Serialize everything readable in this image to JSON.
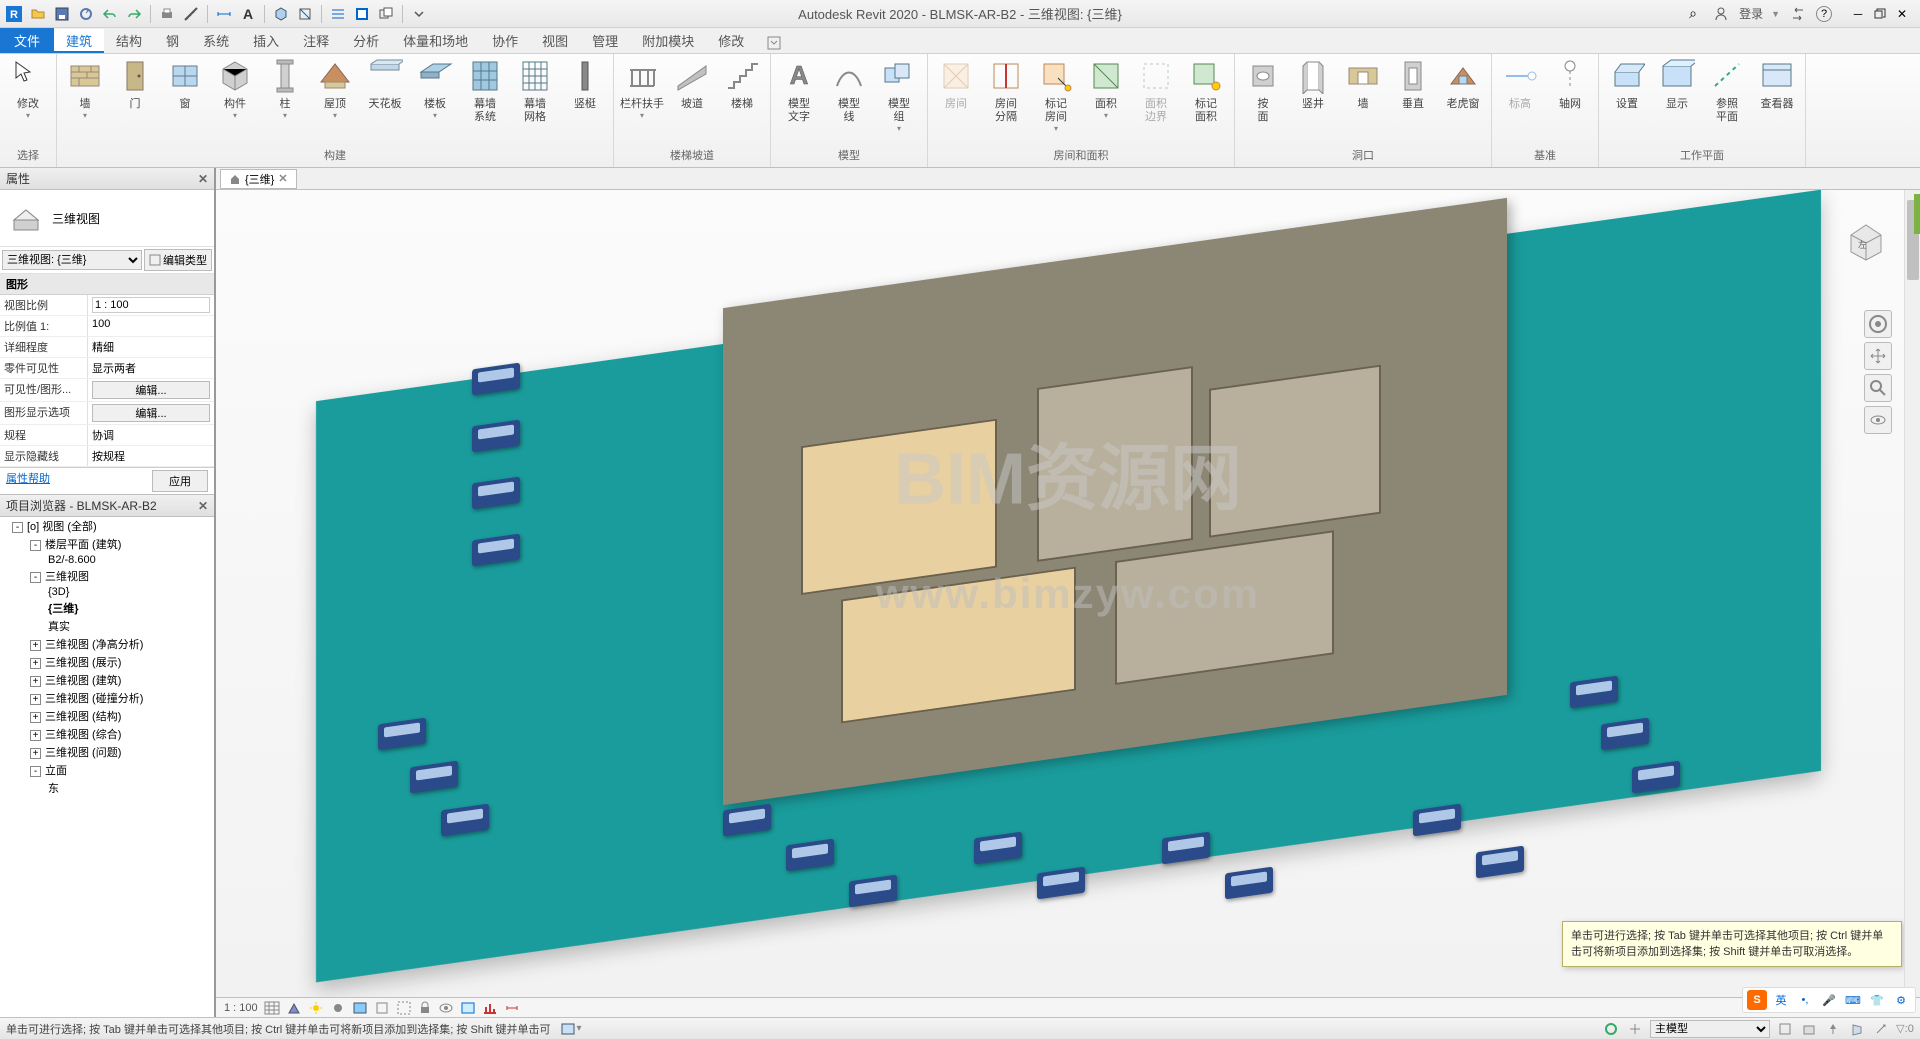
{
  "title": "Autodesk Revit 2020 - BLMSK-AR-B2 - 三维视图: {三维}",
  "qat_icons": [
    "revit-logo",
    "open",
    "save",
    "sync",
    "undo",
    "redo",
    "sep",
    "print",
    "measure",
    "sep",
    "dimension",
    "text-a",
    "sep",
    "3d-view",
    "section",
    "sep",
    "thin-lines",
    "close-hidden",
    "switch-windows",
    "sep",
    "customize-down"
  ],
  "login_label": "登录",
  "help_icon": "?",
  "search_icon": "⌕",
  "file_tab": "文件",
  "ribbon_tabs": [
    "建筑",
    "结构",
    "钢",
    "系统",
    "插入",
    "注释",
    "分析",
    "体量和场地",
    "协作",
    "视图",
    "管理",
    "附加模块",
    "修改"
  ],
  "ribbon_active": 0,
  "ribbon_groups": [
    {
      "label": "选择",
      "buttons": [
        {
          "icon": "cursor",
          "label": "修改",
          "drop": true
        }
      ]
    },
    {
      "label": "构建",
      "buttons": [
        {
          "icon": "wall",
          "label": "墙",
          "drop": true
        },
        {
          "icon": "door",
          "label": "门"
        },
        {
          "icon": "window",
          "label": "窗"
        },
        {
          "icon": "component",
          "label": "构件",
          "drop": true
        },
        {
          "icon": "column",
          "label": "柱",
          "drop": true
        },
        {
          "icon": "roof",
          "label": "屋顶",
          "drop": true
        },
        {
          "icon": "ceiling",
          "label": "天花板"
        },
        {
          "icon": "floor",
          "label": "楼板",
          "drop": true
        },
        {
          "icon": "curtain-sys",
          "label": "幕墙\n系统"
        },
        {
          "icon": "curtain-grid",
          "label": "幕墙\n网格"
        },
        {
          "icon": "mullion",
          "label": "竖梃"
        }
      ]
    },
    {
      "label": "楼梯坡道",
      "buttons": [
        {
          "icon": "railing",
          "label": "栏杆扶手",
          "drop": true
        },
        {
          "icon": "ramp",
          "label": "坡道"
        },
        {
          "icon": "stair",
          "label": "楼梯"
        }
      ]
    },
    {
      "label": "模型",
      "buttons": [
        {
          "icon": "model-text",
          "label": "模型\n文字"
        },
        {
          "icon": "model-line",
          "label": "模型\n线"
        },
        {
          "icon": "model-group",
          "label": "模型\n组",
          "drop": true
        }
      ]
    },
    {
      "label": "房间和面积",
      "buttons": [
        {
          "icon": "room",
          "label": "房间",
          "disabled": true
        },
        {
          "icon": "room-sep",
          "label": "房间\n分隔"
        },
        {
          "icon": "tag-room",
          "label": "标记\n房间",
          "drop": true
        },
        {
          "icon": "area",
          "label": "面积",
          "drop": true
        },
        {
          "icon": "area-bound",
          "label": "面积\n边界",
          "disabled": true
        },
        {
          "icon": "tag-area",
          "label": "标记\n面积"
        }
      ]
    },
    {
      "label": "洞口",
      "buttons": [
        {
          "icon": "by-face",
          "label": "按\n面"
        },
        {
          "icon": "shaft",
          "label": "竖井"
        },
        {
          "icon": "wall-open",
          "label": "墙"
        },
        {
          "icon": "vertical",
          "label": "垂直"
        },
        {
          "icon": "dormer",
          "label": "老虎窗"
        }
      ]
    },
    {
      "label": "基准",
      "buttons": [
        {
          "icon": "level",
          "label": "标高",
          "disabled": true
        },
        {
          "icon": "grid",
          "label": "轴网"
        }
      ]
    },
    {
      "label": "工作平面",
      "buttons": [
        {
          "icon": "set",
          "label": "设置"
        },
        {
          "icon": "show",
          "label": "显示"
        },
        {
          "icon": "ref-plane",
          "label": "参照\n平面"
        },
        {
          "icon": "viewer",
          "label": "查看器"
        }
      ]
    }
  ],
  "properties": {
    "panel_title": "属性",
    "type_name": "三维视图",
    "instance_combo": "三维视图: {三维}",
    "edit_type": "编辑类型",
    "group_header": "图形",
    "rows": [
      {
        "k": "视图比例",
        "v": "1 : 100",
        "input": true
      },
      {
        "k": "比例值 1:",
        "v": "100"
      },
      {
        "k": "详细程度",
        "v": "精细"
      },
      {
        "k": "零件可见性",
        "v": "显示两者"
      },
      {
        "k": "可见性/图形...",
        "v": "编辑...",
        "btn": true
      },
      {
        "k": "图形显示选项",
        "v": "编辑...",
        "btn": true
      },
      {
        "k": "规程",
        "v": "协调"
      },
      {
        "k": "显示隐藏线",
        "v": "按规程"
      }
    ],
    "help_link": "属性帮助",
    "apply": "应用"
  },
  "browser": {
    "panel_title": "项目浏览器 - BLMSK-AR-B2",
    "items": [
      {
        "l": 1,
        "t": "-",
        "label": "[o] 视图 (全部)"
      },
      {
        "l": 2,
        "t": "-",
        "label": "楼层平面 (建筑)"
      },
      {
        "l": 3,
        "t": "",
        "label": "B2/-8.600"
      },
      {
        "l": 2,
        "t": "-",
        "label": "三维视图"
      },
      {
        "l": 3,
        "t": "",
        "label": "{3D}"
      },
      {
        "l": 3,
        "t": "",
        "label": "{三维}",
        "bold": true
      },
      {
        "l": 3,
        "t": "",
        "label": "真实"
      },
      {
        "l": 2,
        "t": "+",
        "label": "三维视图 (净高分析)"
      },
      {
        "l": 2,
        "t": "+",
        "label": "三维视图 (展示)"
      },
      {
        "l": 2,
        "t": "+",
        "label": "三维视图 (建筑)"
      },
      {
        "l": 2,
        "t": "+",
        "label": "三维视图 (碰撞分析)"
      },
      {
        "l": 2,
        "t": "+",
        "label": "三维视图 (结构)"
      },
      {
        "l": 2,
        "t": "+",
        "label": "三维视图 (综合)"
      },
      {
        "l": 2,
        "t": "+",
        "label": "三维视图 (问题)"
      },
      {
        "l": 2,
        "t": "-",
        "label": "立面"
      },
      {
        "l": 3,
        "t": "",
        "label": "东"
      }
    ]
  },
  "view_tab": {
    "icon": "home",
    "label": "{三维}"
  },
  "watermark1": "BIM资源网",
  "watermark2": "www.bimzyw.com",
  "viewcontrol_scale": "1 : 100",
  "tooltip": "单击可进行选择; 按 Tab 键并单击可选择其他项目; 按 Ctrl 键并单击可将新项目添加到选择集; 按 Shift 键并单击可取消选择。",
  "status_text": "单击可进行选择; 按 Tab 键并单击可选择其他项目; 按 Ctrl 键并单击可将新项目添加到选择集; 按 Shift 键并单击可",
  "status_combo": "主模型",
  "ime": {
    "logo": "S",
    "lang": "英"
  }
}
